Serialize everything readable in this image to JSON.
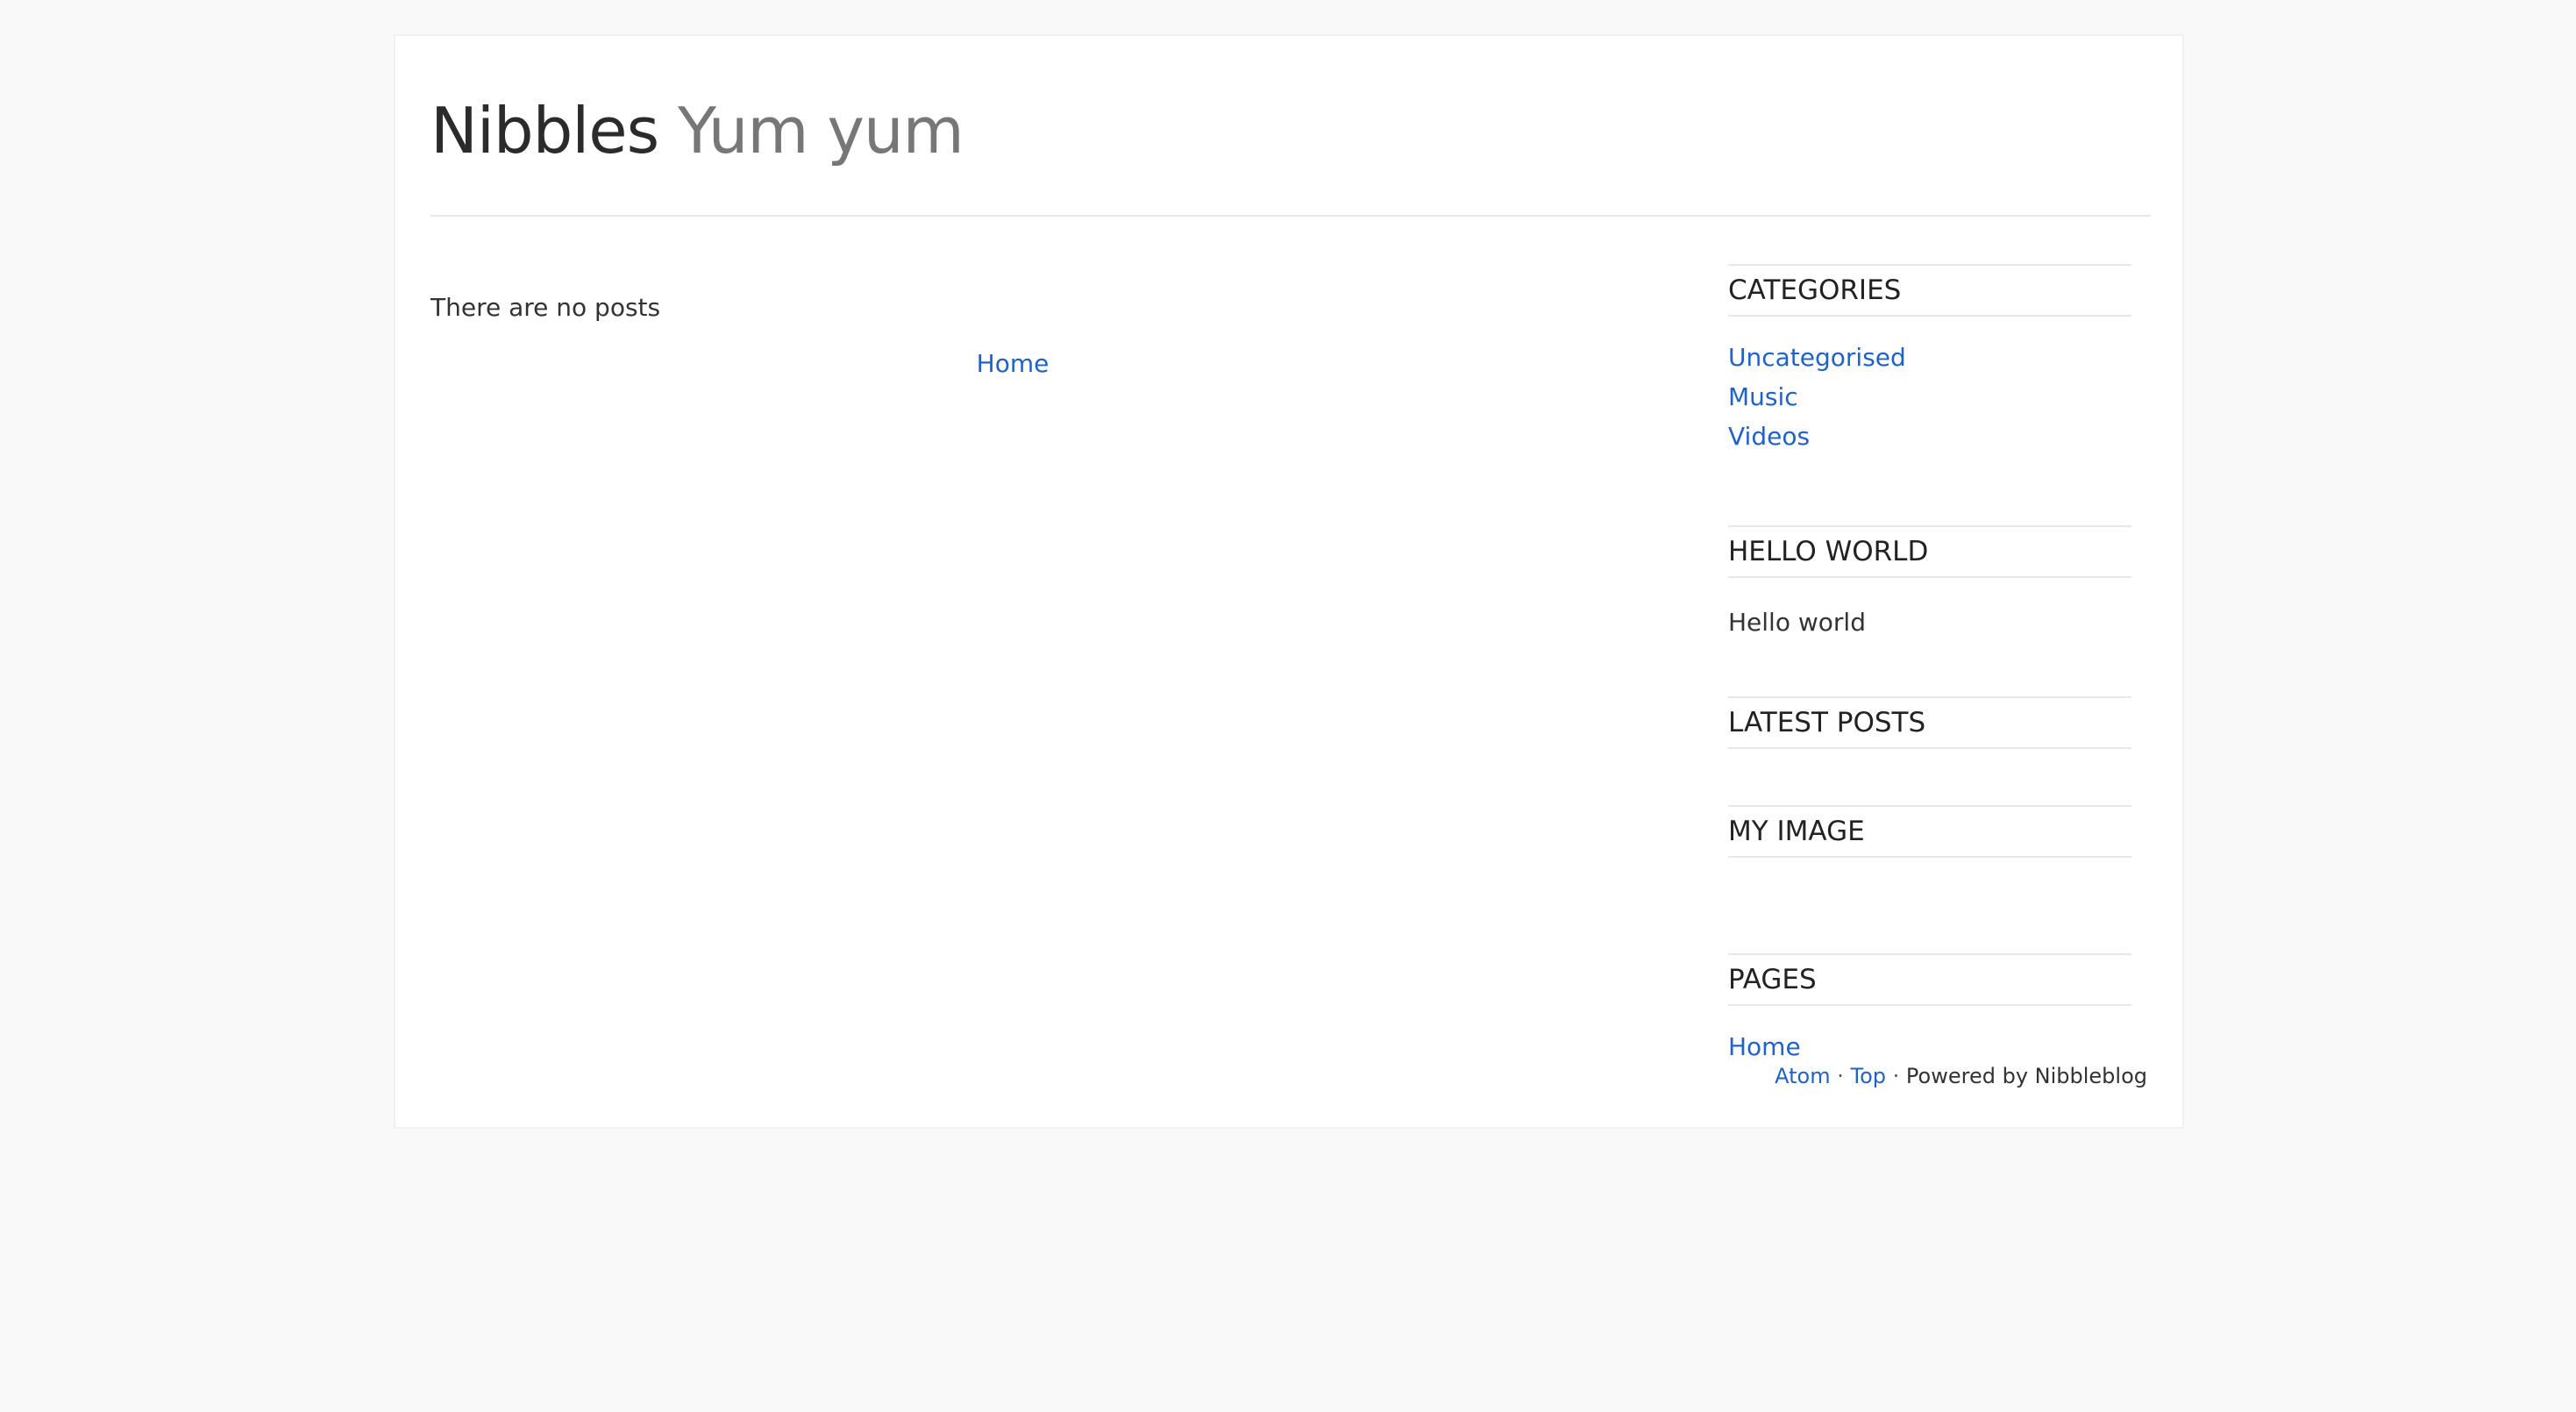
{
  "header": {
    "site_title": "Nibbles",
    "site_slogan": "Yum yum"
  },
  "main": {
    "empty_message": "There are no posts",
    "pager_home": "Home"
  },
  "sidebar": {
    "categories": {
      "title": "CATEGORIES",
      "items": [
        "Uncategorised",
        "Music",
        "Videos"
      ]
    },
    "hello_world": {
      "title": "HELLO WORLD",
      "text": "Hello world"
    },
    "latest_posts": {
      "title": "LATEST POSTS"
    },
    "my_image": {
      "title": "MY IMAGE"
    },
    "pages": {
      "title": "PAGES",
      "items": [
        "Home"
      ]
    }
  },
  "footer": {
    "atom": "Atom",
    "separator": "·",
    "top": "Top",
    "powered_by": "Powered by Nibbleblog"
  },
  "colors": {
    "link": "#1f63c6",
    "page_background": "#f9f9f9",
    "container_background": "#ffffff"
  }
}
